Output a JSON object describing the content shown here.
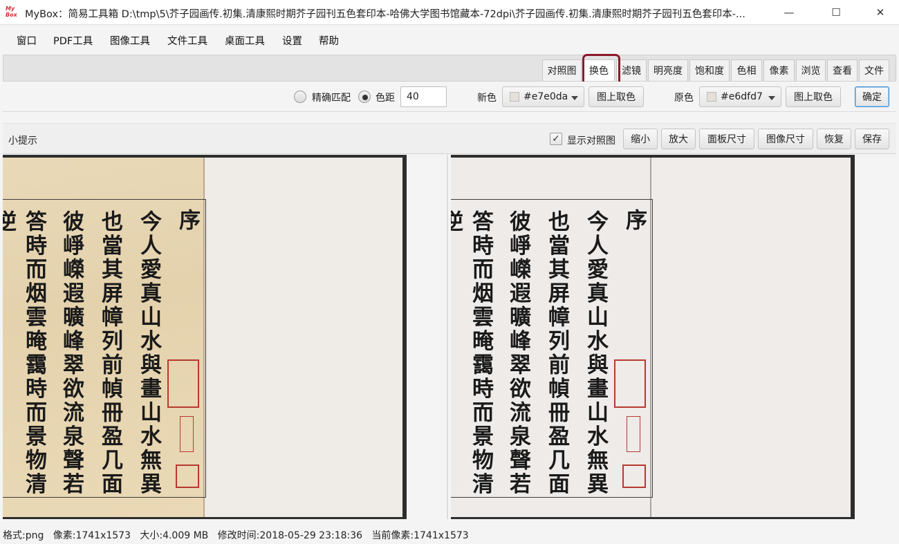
{
  "window": {
    "icon_text": "My Box",
    "title": "MyBox：简易工具箱  D:\\tmp\\5\\芥子园画传.初集.清康熙时期芥子园刊五色套印本-哈佛大学图书馆藏本-72dpi\\芥子园画传.初集.清康熙时期芥子园刊五色套印本-...",
    "minimize": "—",
    "maximize": "☐",
    "close": "✕"
  },
  "menu": [
    "窗口",
    "PDF工具",
    "图像工具",
    "文件工具",
    "桌面工具",
    "设置",
    "帮助"
  ],
  "tabs": [
    "对照图",
    "换色",
    "滤镜",
    "明亮度",
    "饱和度",
    "色相",
    "像素",
    "浏览",
    "查看",
    "文件"
  ],
  "active_tab": "换色",
  "options": {
    "exact_match_label": "精确匹配",
    "distance_label": "色距",
    "distance_value": "40",
    "new_color_label": "新色",
    "new_color_value": "#e7e0da",
    "pick_button": "图上取色",
    "orig_color_label": "原色",
    "orig_color_value": "#e6dfd7",
    "confirm_button": "确定"
  },
  "viewbar": {
    "tips_label": "小提示",
    "show_compare_label": "显示对照图",
    "show_compare_checked": true,
    "buttons": [
      "缩小",
      "放大",
      "面板尺寸",
      "图像尺寸",
      "恢复",
      "保存"
    ]
  },
  "image_text": {
    "header": "序",
    "columns": [
      "今人愛真山水與畫山水無異",
      "也當其屏幛列前幀冊盈几面",
      "彼崢嶸遐曠峰翠欲流泉聲若",
      "答時而烟雲晻靄時而景物清",
      "逆"
    ]
  },
  "status": {
    "format": "格式:png",
    "pixels": "像素:1741x1573",
    "size": "大小:4.009 MB",
    "modified": "修改时间:2018-05-29 23:18:36",
    "current_pixels": "当前像素:1741x1573"
  },
  "colors": {
    "accent_highlight": "#8b1a2b",
    "new_color": "#e7e0da",
    "orig_color": "#e6dfd7",
    "original_paper": "#e7d7b6",
    "recolored_paper": "#eeebe9",
    "seal_red": "#b5392f"
  }
}
